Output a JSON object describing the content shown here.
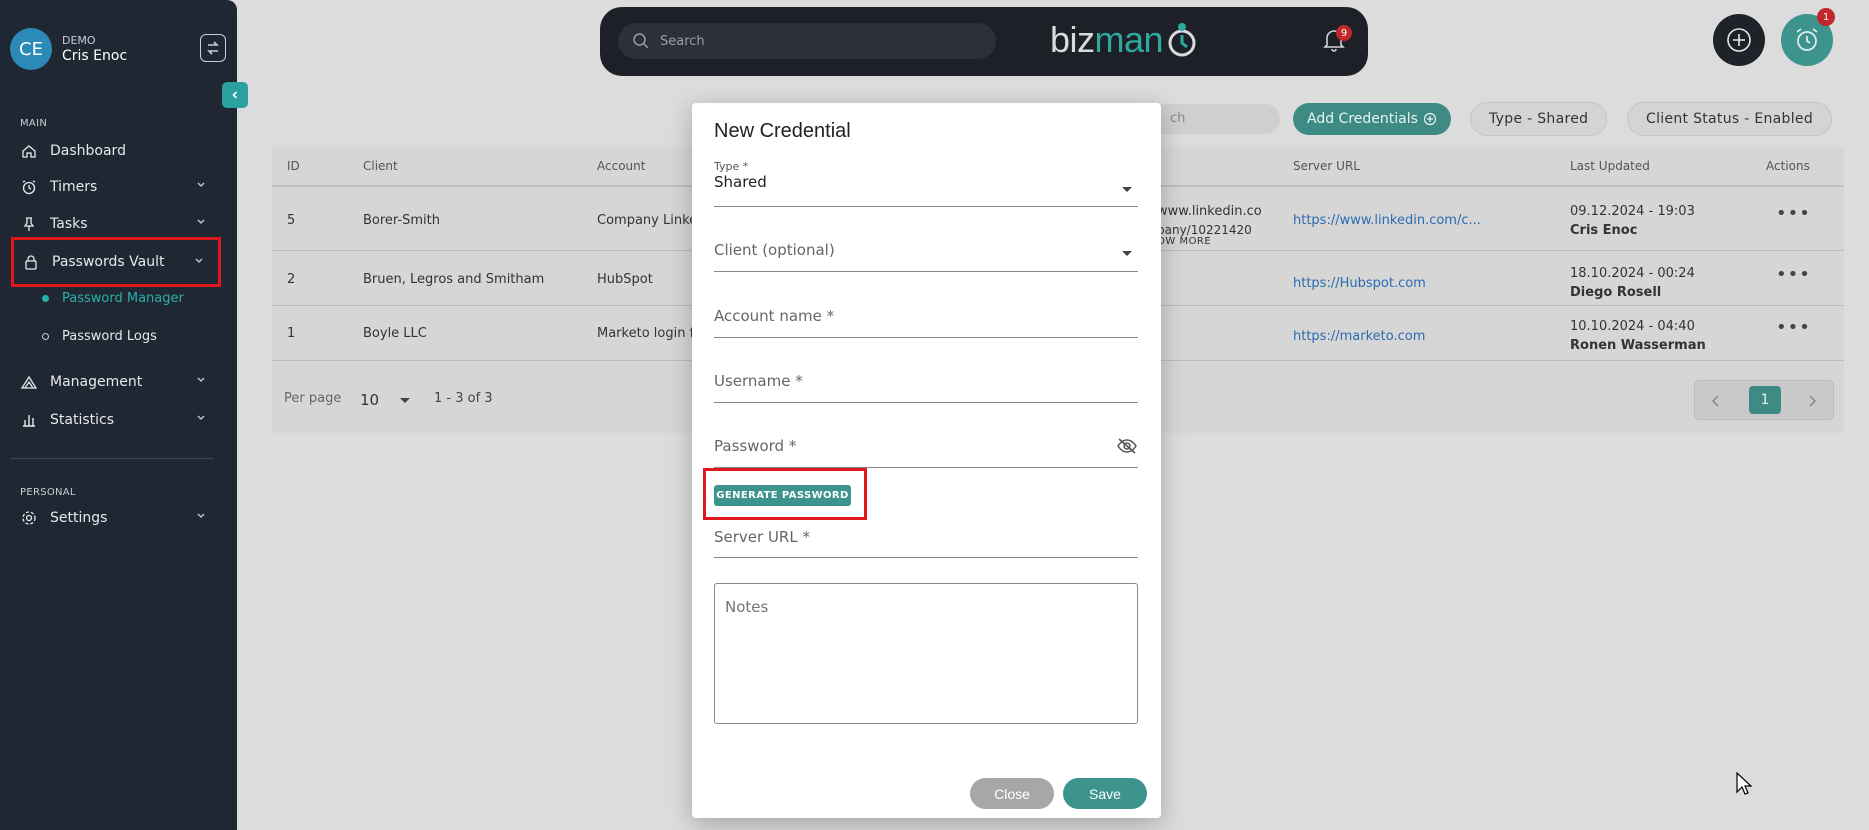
{
  "user": {
    "initials": "CE",
    "org": "DEMO",
    "name": "Cris Enoc"
  },
  "sidebar": {
    "section_main": "MAIN",
    "section_personal": "PERSONAL",
    "items": [
      {
        "label": "Dashboard",
        "icon": "home-icon"
      },
      {
        "label": "Timers",
        "icon": "timer-icon"
      },
      {
        "label": "Tasks",
        "icon": "pin-icon"
      },
      {
        "label": "Passwords Vault",
        "icon": "lock-icon"
      },
      {
        "label": "Management",
        "icon": "management-icon"
      },
      {
        "label": "Statistics",
        "icon": "bar-chart-icon"
      },
      {
        "label": "Settings",
        "icon": "gear-icon"
      }
    ],
    "sub_items": [
      {
        "label": "Password Manager",
        "active": true
      },
      {
        "label": "Password Logs",
        "active": false
      }
    ]
  },
  "topbar": {
    "search_placeholder": "Search",
    "logo_biz": "biz",
    "logo_man": "man",
    "notification_count": "9",
    "timer_count": "1"
  },
  "filters": {
    "search_placeholder_fragment": "ch",
    "add_credentials": "Add Credentials",
    "type_pill": "Type - Shared",
    "status_pill": "Client Status - Enabled"
  },
  "table": {
    "headers": {
      "id": "ID",
      "client": "Client",
      "account": "Account",
      "server_url": "Server URL",
      "last_updated": "Last Updated",
      "actions": "Actions"
    },
    "rows": [
      {
        "id": "5",
        "client": "Borer-Smith",
        "account": "Company Linke",
        "username_line1": "www.linkedin.co",
        "username_line2": "pany/10221420",
        "show_more": "OW MORE",
        "url": "https://www.linkedin.com/c...",
        "date": "09.12.2024 - 19:03",
        "updated_by": "Cris Enoc"
      },
      {
        "id": "2",
        "client": "Bruen, Legros and Smitham",
        "account": "HubSpot",
        "url": "https://Hubspot.com",
        "date": "18.10.2024 - 00:24",
        "updated_by": "Diego Rosell"
      },
      {
        "id": "1",
        "client": "Boyle LLC",
        "account": "Marketo login f",
        "url": "https://marketo.com",
        "date": "10.10.2024 - 04:40",
        "updated_by": "Ronen Wasserman"
      }
    ],
    "per_page_label": "Per page",
    "per_page_value": "10",
    "range": "1 - 3 of 3",
    "current_page": "1"
  },
  "modal": {
    "title": "New Credential",
    "type_label": "Type *",
    "type_value": "Shared",
    "client_placeholder": "Client (optional)",
    "account_placeholder": "Account name *",
    "username_placeholder": "Username *",
    "password_placeholder": "Password *",
    "generate_label": "GENERATE PASSWORD",
    "server_url_placeholder": "Server URL *",
    "notes_placeholder": "Notes",
    "close_label": "Close",
    "save_label": "Save"
  },
  "colors": {
    "accent": "#3d948c",
    "sidebar_bg": "#1f2733",
    "highlight": "#e0181e",
    "link": "#2b6cb0"
  }
}
